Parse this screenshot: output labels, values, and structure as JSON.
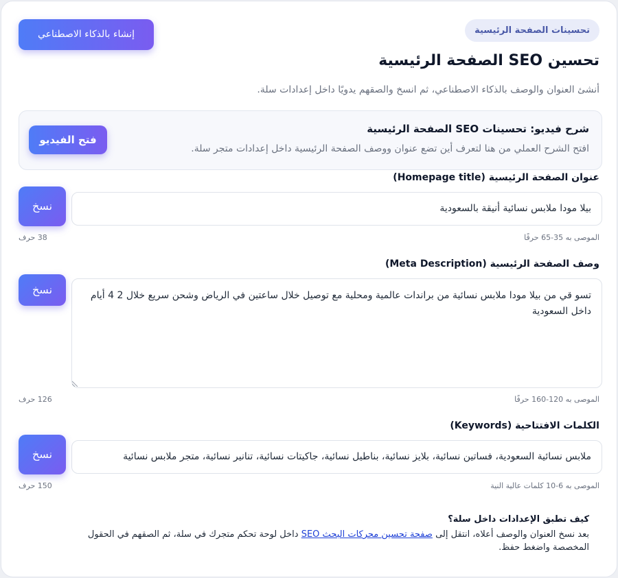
{
  "header": {
    "tag": "تحسينات الصفحة الرئيسية",
    "ai_button": "إنشاء بالذكاء الاصطناعي",
    "title": "تحسين SEO الصفحة الرئيسية",
    "subtitle": "أنشئ العنوان والوصف بالذكاء الاصطناعي، ثم انسخ والصقهم يدويًا داخل إعدادات سلة."
  },
  "video": {
    "title": "شرح فيديو: تحسينات SEO الصفحة الرئيسية",
    "description": "افتح الشرح العملي من هنا لتعرف أين تضع عنوان ووصف الصفحة الرئيسية داخل إعدادات متجر سلة.",
    "button": "فتح الفيديو"
  },
  "fields": {
    "title": {
      "label": "عنوان الصفحة الرئيسية (Homepage title)",
      "value": "بيلا مودا ملابس نسائية أنيقة بالسعودية",
      "hint": "الموصى به 35-65 حرفًا",
      "count": "38 حرف",
      "copy": "نسخ"
    },
    "description": {
      "label": "وصف الصفحة الرئيسية (Meta Description)",
      "value": "تسو ﻗﻲ من بيلا مودا ملابس نسائية من براندات عالمية ومحلية مع توصيل خلال ساعتين في الرياض وشحن سريع خلال 2 4 أيام داخل السعودية",
      "hint": "الموصى به 120-160 حرفًا",
      "count": "126 حرف",
      "copy": "نسخ"
    },
    "keywords": {
      "label": "الكلمات الافتتاحية (Keywords)",
      "value": "ملابس نسائية السعودية، فساتين نسائية، بلايز نسائية، بناطيل نسائية، جاكيتات نسائية، تنانير نسائية، متجر ملابس نسائية",
      "hint": "الموصى به 6-10 كلمات عالية النية",
      "count": "150 حرف",
      "copy": "نسخ"
    }
  },
  "how": {
    "title": "كيف تطبق الإعدادات داخل سلة؟",
    "text_before": "بعد نسخ العنوان والوصف أعلاه، انتقل إلى",
    "link": "صفحة تحسين محركات البحث SEO",
    "text_after": "داخل لوحة تحكم متجرك في سلة، ثم الصقهم في الحقول المخصصة واضغط حفظ."
  },
  "colors": {
    "accent_start": "#4f7cf7",
    "accent_end": "#7a5cf0",
    "tag_bg": "#e9ecf9",
    "link": "#1d3fd6"
  }
}
